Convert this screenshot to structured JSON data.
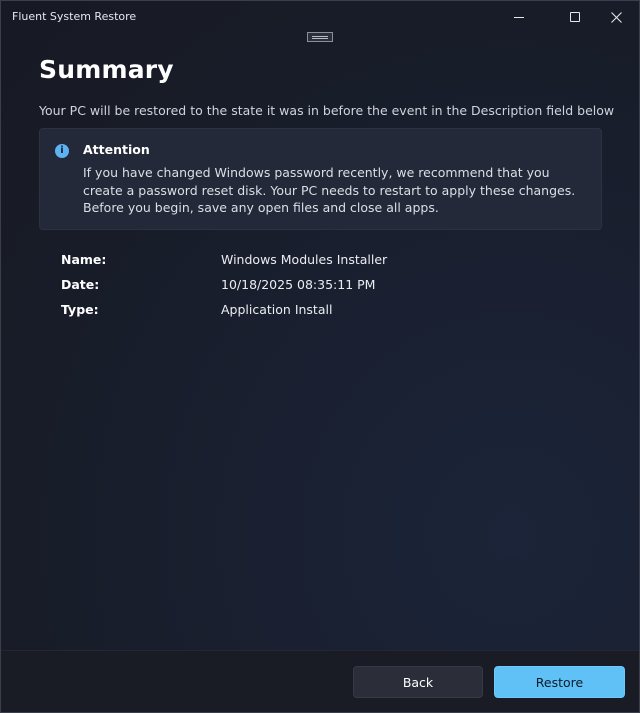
{
  "window": {
    "title": "Fluent System Restore"
  },
  "caption_buttons": {
    "minimize": "minimize-icon",
    "maximize": "maximize-icon",
    "close": "✕"
  },
  "page": {
    "title": "Summary",
    "subtitle": "Your PC will be restored to the state it was in before the event in the Description field below"
  },
  "infobar": {
    "icon": "i",
    "title": "Attention",
    "message": "If you have changed Windows password recently, we recommend that you create a password reset disk. Your PC needs to restart to apply these changes. Before you begin, save any open files and close all apps."
  },
  "details": {
    "name_label": "Name:",
    "name_value": "Windows Modules Installer",
    "date_label": "Date:",
    "date_value": "10/18/2025 08:35:11 PM",
    "type_label": "Type:",
    "type_value": "Application Install"
  },
  "footer": {
    "back_label": "Back",
    "restore_label": "Restore"
  },
  "colors": {
    "accent": "#5fc1f6",
    "info_icon": "#5fb2f2",
    "background": "#181c28"
  }
}
